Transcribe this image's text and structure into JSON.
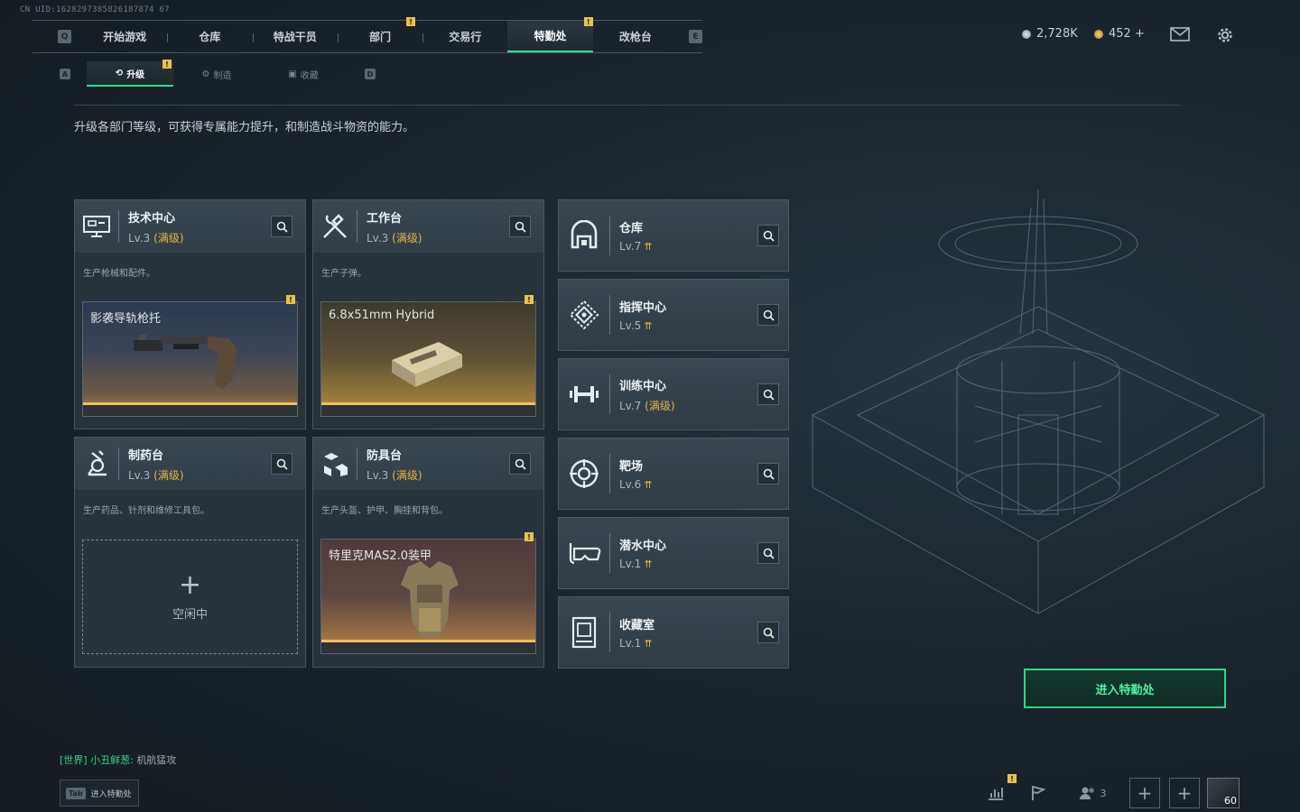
{
  "uid": "CN UID:1628297385826187874 67",
  "top_nav": {
    "left_key": "Q",
    "right_key": "E",
    "tabs": [
      {
        "label": "开始游戏"
      },
      {
        "label": "仓库"
      },
      {
        "label": "特战干员"
      },
      {
        "label": "部门",
        "badge": "!"
      },
      {
        "label": "交易行"
      },
      {
        "label": "特勤处",
        "badge": "!"
      },
      {
        "label": "改枪台"
      }
    ]
  },
  "currency": {
    "silver": "2,728K",
    "gold": "452 +"
  },
  "sub_nav": {
    "left_key": "A",
    "right_key": "D",
    "tabs": [
      {
        "label": "升级",
        "badge": "!"
      },
      {
        "label": "制造"
      },
      {
        "label": "收藏"
      }
    ]
  },
  "description": "升级各部门等级，可获得专属能力提升，和制造战斗物资的能力。",
  "departments": [
    {
      "name": "技术中心",
      "level": "Lv.3",
      "max": "(满级)",
      "desc": "生产枪械和配件。",
      "craft": "影袭导轨枪托",
      "badge": "!",
      "icon": "monitor-icon"
    },
    {
      "name": "工作台",
      "level": "Lv.3",
      "max": "(满级)",
      "desc": "生产子弹。",
      "craft": "6.8x51mm Hybrid",
      "badge": "!",
      "icon": "tools-icon"
    },
    {
      "name": "制药台",
      "level": "Lv.3",
      "max": "(满级)",
      "desc": "生产药品、针剂和维修工具包。",
      "idle": "空闲中",
      "icon": "microscope-icon"
    },
    {
      "name": "防具台",
      "level": "Lv.3",
      "max": "(满级)",
      "desc": "生产头盔、护甲、胸挂和背包。",
      "craft": "特里克MAS2.0装甲",
      "badge": "!",
      "icon": "armor-blocks-icon"
    }
  ],
  "facilities": [
    {
      "name": "仓库",
      "level": "Lv.7",
      "upgrade": "⇈",
      "icon": "warehouse-icon"
    },
    {
      "name": "指挥中心",
      "level": "Lv.5",
      "upgrade": "⇈",
      "icon": "command-icon"
    },
    {
      "name": "训练中心",
      "level": "Lv.7",
      "max": "(满级)",
      "icon": "dumbbell-icon"
    },
    {
      "name": "靶场",
      "level": "Lv.6",
      "upgrade": "⇈",
      "icon": "target-icon"
    },
    {
      "name": "潜水中心",
      "level": "Lv.1",
      "upgrade": "⇈",
      "icon": "diving-mask-icon"
    },
    {
      "name": "收藏室",
      "level": "Lv.1",
      "upgrade": "⇈",
      "icon": "collection-icon"
    }
  ],
  "enter_button": "进入特勤处",
  "chat": {
    "channel": "[世界]",
    "sender": "小丑鲜葱:",
    "message": "机航猛攻"
  },
  "tab_hint": {
    "key": "Tab",
    "label": "进入特勤处"
  },
  "bottom": {
    "friends": "3",
    "level": "60",
    "stats_badge": "!"
  },
  "colors": {
    "accent": "#2ee08a",
    "badge": "#e8c24a",
    "max_level": "#e2b54a"
  }
}
